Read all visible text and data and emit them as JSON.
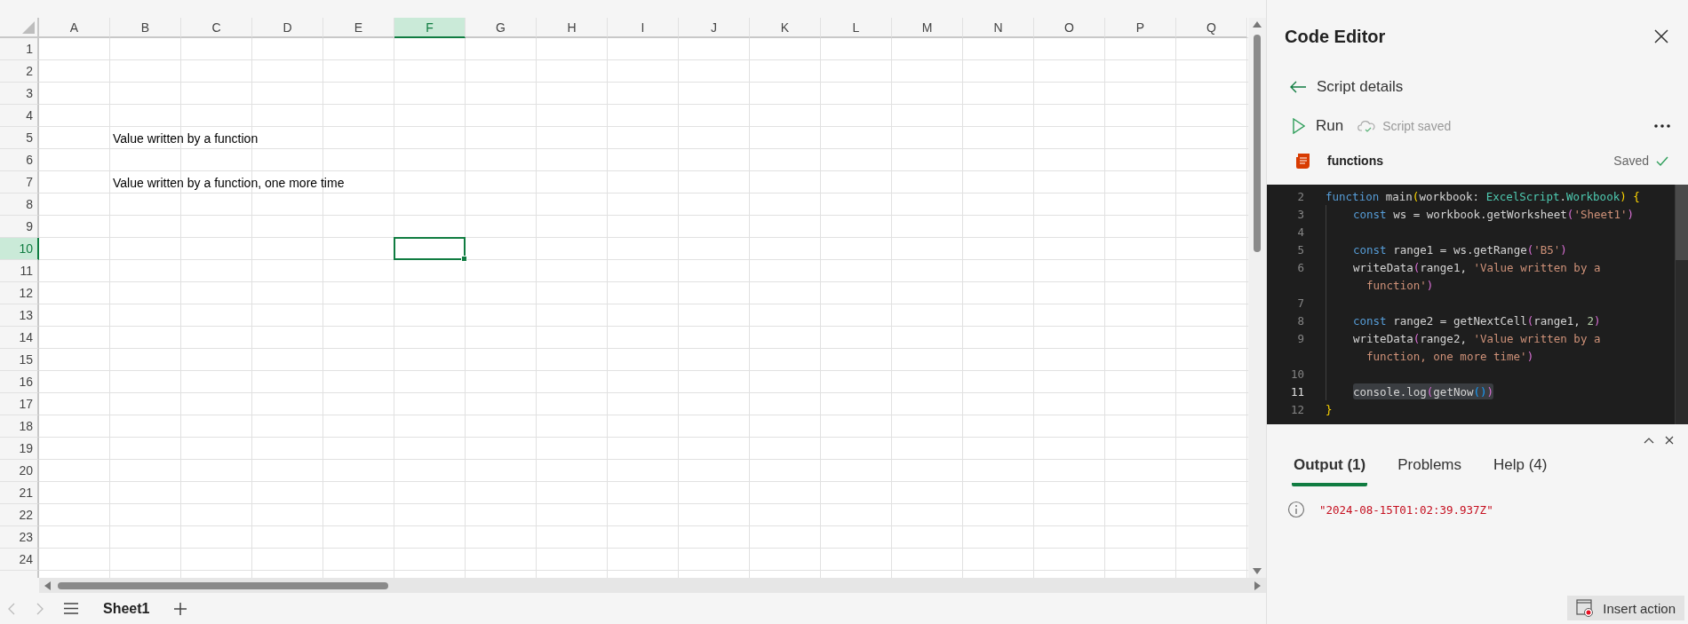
{
  "spreadsheet": {
    "columns": [
      {
        "label": "A",
        "selected": false
      },
      {
        "label": "B",
        "selected": false
      },
      {
        "label": "C",
        "selected": false
      },
      {
        "label": "D",
        "selected": false
      },
      {
        "label": "E",
        "selected": false
      },
      {
        "label": "F",
        "selected": true
      },
      {
        "label": "G",
        "selected": false
      },
      {
        "label": "H",
        "selected": false
      },
      {
        "label": "I",
        "selected": false
      },
      {
        "label": "J",
        "selected": false
      },
      {
        "label": "K",
        "selected": false
      },
      {
        "label": "L",
        "selected": false
      },
      {
        "label": "M",
        "selected": false
      },
      {
        "label": "N",
        "selected": false
      },
      {
        "label": "O",
        "selected": false
      },
      {
        "label": "P",
        "selected": false
      },
      {
        "label": "Q",
        "selected": false
      }
    ],
    "rows": [
      {
        "label": "1",
        "selected": false
      },
      {
        "label": "2",
        "selected": false
      },
      {
        "label": "3",
        "selected": false
      },
      {
        "label": "4",
        "selected": false
      },
      {
        "label": "5",
        "selected": false,
        "cells": {
          "B": "Value written by a function"
        }
      },
      {
        "label": "6",
        "selected": false
      },
      {
        "label": "7",
        "selected": false,
        "cells": {
          "B": "Value written by a function, one more time"
        }
      },
      {
        "label": "8",
        "selected": false
      },
      {
        "label": "9",
        "selected": false
      },
      {
        "label": "10",
        "selected": true
      },
      {
        "label": "11",
        "selected": false
      },
      {
        "label": "12",
        "selected": false
      },
      {
        "label": "13",
        "selected": false
      },
      {
        "label": "14",
        "selected": false
      },
      {
        "label": "15",
        "selected": false
      },
      {
        "label": "16",
        "selected": false
      },
      {
        "label": "17",
        "selected": false
      },
      {
        "label": "18",
        "selected": false
      },
      {
        "label": "19",
        "selected": false
      },
      {
        "label": "20",
        "selected": false
      },
      {
        "label": "21",
        "selected": false
      },
      {
        "label": "22",
        "selected": false
      },
      {
        "label": "23",
        "selected": false
      },
      {
        "label": "24",
        "selected": false
      }
    ],
    "sheet_tabs": [
      {
        "label": "Sheet1",
        "selected": true
      }
    ]
  },
  "editor": {
    "title": "Code Editor",
    "back_label": "Script details",
    "run_label": "Run",
    "save_status": "Script saved",
    "script_name": "functions",
    "saved_label": "Saved",
    "code": [
      {
        "kind": "top",
        "number": "2",
        "current": false,
        "highlighted": false,
        "tokens": [
          {
            "kind": "kw",
            "text": "function"
          },
          {
            "kind": "pl",
            "text": " main"
          },
          {
            "kind": "b1",
            "text": "("
          },
          {
            "kind": "pl",
            "text": "workbook: "
          },
          {
            "kind": "ty",
            "text": "ExcelScript"
          },
          {
            "kind": "pl",
            "text": "."
          },
          {
            "kind": "ty",
            "text": "Workbook"
          },
          {
            "kind": "b1",
            "text": ")"
          },
          {
            "kind": "b1",
            "text": " {"
          }
        ]
      },
      {
        "kind": "body",
        "number": "3",
        "current": false,
        "highlighted": false,
        "tokens": [
          {
            "kind": "kw",
            "text": "const"
          },
          {
            "kind": "pl",
            "text": " ws = workbook.getWorksheet"
          },
          {
            "kind": "b2",
            "text": "("
          },
          {
            "kind": "st",
            "text": "'Sheet1'"
          },
          {
            "kind": "b2",
            "text": ")"
          }
        ]
      },
      {
        "kind": "body",
        "number": "4",
        "current": false,
        "highlighted": false
      },
      {
        "kind": "body",
        "number": "5",
        "current": false,
        "highlighted": false,
        "tokens": [
          {
            "kind": "kw",
            "text": "const"
          },
          {
            "kind": "pl",
            "text": " range1 = ws.getRange"
          },
          {
            "kind": "b2",
            "text": "("
          },
          {
            "kind": "st",
            "text": "'B5'"
          },
          {
            "kind": "b2",
            "text": ")"
          }
        ]
      },
      {
        "kind": "body",
        "number": "6",
        "current": false,
        "highlighted": false,
        "tokens": [
          {
            "kind": "pl",
            "text": "writeData"
          },
          {
            "kind": "b2",
            "text": "("
          },
          {
            "kind": "pl",
            "text": "range1, "
          },
          {
            "kind": "st",
            "text": "'Value written by a"
          }
        ]
      },
      {
        "kind": "wrap",
        "highlighted": false,
        "tokens": [
          {
            "kind": "st",
            "text": "function'"
          },
          {
            "kind": "b2",
            "text": ")"
          }
        ]
      },
      {
        "kind": "body",
        "number": "7",
        "current": false,
        "highlighted": false
      },
      {
        "kind": "body",
        "number": "8",
        "current": false,
        "highlighted": false,
        "tokens": [
          {
            "kind": "kw",
            "text": "const"
          },
          {
            "kind": "pl",
            "text": " range2 = getNextCell"
          },
          {
            "kind": "b2",
            "text": "("
          },
          {
            "kind": "pl",
            "text": "range1, "
          },
          {
            "kind": "nu",
            "text": "2"
          },
          {
            "kind": "b2",
            "text": ")"
          }
        ]
      },
      {
        "kind": "body",
        "number": "9",
        "current": false,
        "highlighted": false,
        "tokens": [
          {
            "kind": "pl",
            "text": "writeData"
          },
          {
            "kind": "b2",
            "text": "("
          },
          {
            "kind": "pl",
            "text": "range2, "
          },
          {
            "kind": "st",
            "text": "'Value written by a"
          }
        ]
      },
      {
        "kind": "wrap",
        "highlighted": false,
        "tokens": [
          {
            "kind": "st",
            "text": "function, one more time'"
          },
          {
            "kind": "b2",
            "text": ")"
          }
        ]
      },
      {
        "kind": "body",
        "number": "10",
        "current": false,
        "highlighted": false
      },
      {
        "kind": "body",
        "number": "11",
        "current": true,
        "highlighted": true,
        "tokens": [
          {
            "kind": "pl",
            "text": "console.log"
          },
          {
            "kind": "b2",
            "text": "("
          },
          {
            "kind": "pl",
            "text": "getNow"
          },
          {
            "kind": "b3",
            "text": "()"
          },
          {
            "kind": "b2",
            "text": ")"
          }
        ]
      },
      {
        "kind": "top",
        "number": "12",
        "current": false,
        "highlighted": false,
        "tokens": [
          {
            "kind": "b1",
            "text": "}"
          }
        ]
      }
    ]
  },
  "output": {
    "tabs": [
      {
        "label": "Output (1)",
        "selected": true
      },
      {
        "label": "Problems",
        "selected": false
      },
      {
        "label": "Help (4)",
        "selected": false
      }
    ],
    "messages": [
      {
        "kind": "info",
        "text": "\"2024-08-15T01:02:39.937Z\""
      }
    ]
  },
  "insert_action": "Insert action"
}
